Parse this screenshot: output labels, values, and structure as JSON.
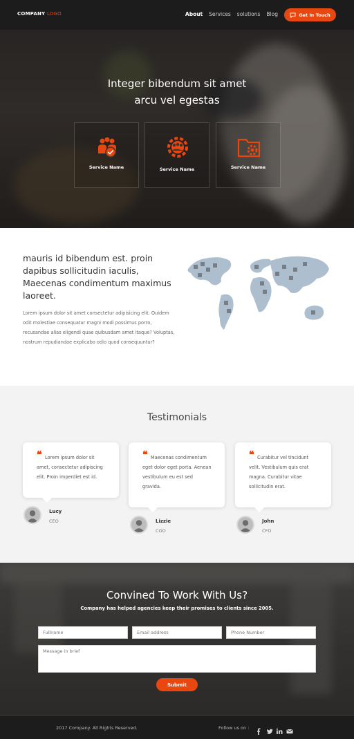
{
  "header": {
    "logo_main": "COMPANY",
    "logo_accent": "LOGO",
    "nav": [
      {
        "label": "About",
        "active": true
      },
      {
        "label": "Services",
        "active": false
      },
      {
        "label": "solutions",
        "active": false
      },
      {
        "label": "Blog",
        "active": false
      }
    ],
    "cta_label": "Get In Touch",
    "cta_icon": "chat-icon"
  },
  "hero": {
    "title_line1": "Integer bibendum sit amet",
    "title_line2": "arcu vel egestas",
    "services": [
      {
        "label": "Service Name",
        "icon": "team-check-icon"
      },
      {
        "label": "Service Name",
        "icon": "gear-team-icon"
      },
      {
        "label": "Service Name",
        "icon": "folder-gear-icon"
      }
    ]
  },
  "about": {
    "heading": "mauris id bibendum est. proin dapibus sollicitudin iaculis, Maecenas condimentum maximus laoreet.",
    "body": "Lorem ipsum dolor sit amet consectetur adipisicing elit. Quidem odit molestiae consequatur magni modi possimus porro, recusandae alias eligendi quae quibusdam amet itaque? Voluptas, nostrum repudiandae explicabo odio quod consequuntur?"
  },
  "testimonials": {
    "title": "Testimonials",
    "items": [
      {
        "quote": "Lorem ipsum dolor sit amet, consectetur adipiscing elit. Proin imperdiet est id.",
        "name": "Lucy",
        "role": "CEO"
      },
      {
        "quote": "Maecenas condimentum eget dolor eget porta. Aenean vestibulum eu est sed gravida.",
        "name": "Lizzie",
        "role": "COO"
      },
      {
        "quote": "Curabitur vel tincidunt velit. Vestibulum quis erat magna. Curabitur vitae sollicitudin erat.",
        "name": "John",
        "role": "CFO"
      }
    ]
  },
  "contact": {
    "title": "Convined To Work With Us?",
    "subtitle": "Company has helped agencies keep their promises to clients since 2005.",
    "placeholders": {
      "fullname": "Fullname",
      "email": "Email address",
      "phone": "Phone Number",
      "message": "Message in brief"
    },
    "submit_label": "Submit"
  },
  "footer": {
    "copyright": "2017 Company. All Rights Reserved.",
    "follow_label": "Follow us on :",
    "social": [
      "facebook-icon",
      "twitter-icon",
      "linkedin-icon",
      "email-icon"
    ]
  },
  "colors": {
    "accent": "#e8470f",
    "dark": "#1c1c1c",
    "light_section": "#f3f3f3"
  }
}
